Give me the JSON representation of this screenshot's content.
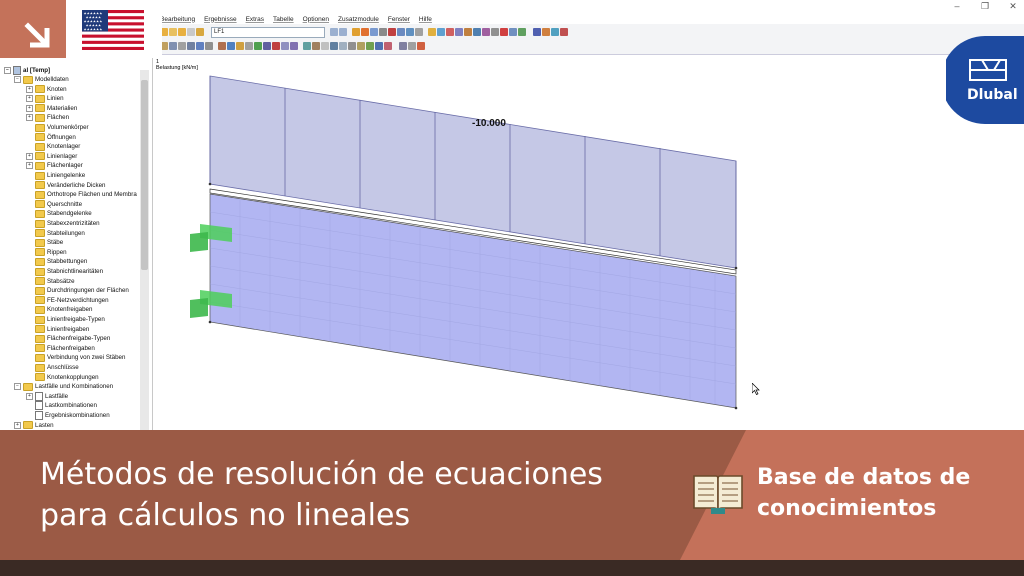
{
  "window": {
    "minimize": "–",
    "restore": "❐",
    "close": "✕"
  },
  "menu": [
    "Bearbeitung",
    "Ergebnisse",
    "Extras",
    "Tabelle",
    "Optionen",
    "Zusatzmodule",
    "Fenster",
    "Hilfe"
  ],
  "toolbar": {
    "loadcase_combo": "LF1"
  },
  "tree": {
    "root": "al [Temp]",
    "items": [
      {
        "label": "Modelldaten",
        "level": 1,
        "expander": "−",
        "icon": "folder"
      },
      {
        "label": "Knoten",
        "level": 2,
        "expander": "+",
        "icon": "folder"
      },
      {
        "label": "Linien",
        "level": 2,
        "expander": "+",
        "icon": "folder"
      },
      {
        "label": "Materialien",
        "level": 2,
        "expander": "+",
        "icon": "folder"
      },
      {
        "label": "Flächen",
        "level": 2,
        "expander": "+",
        "icon": "folder"
      },
      {
        "label": "Volumenkörper",
        "level": 2,
        "expander": "",
        "icon": "folder"
      },
      {
        "label": "Öffnungen",
        "level": 2,
        "expander": "",
        "icon": "folder"
      },
      {
        "label": "Knotenlager",
        "level": 2,
        "expander": "",
        "icon": "folder"
      },
      {
        "label": "Linienlager",
        "level": 2,
        "expander": "+",
        "icon": "folder"
      },
      {
        "label": "Flächenlager",
        "level": 2,
        "expander": "+",
        "icon": "folder"
      },
      {
        "label": "Liniengelenke",
        "level": 2,
        "expander": "",
        "icon": "folder"
      },
      {
        "label": "Veränderliche Dicken",
        "level": 2,
        "expander": "",
        "icon": "folder"
      },
      {
        "label": "Orthotrope Flächen und Membra",
        "level": 2,
        "expander": "",
        "icon": "folder"
      },
      {
        "label": "Querschnitte",
        "level": 2,
        "expander": "",
        "icon": "folder"
      },
      {
        "label": "Stabendgelenke",
        "level": 2,
        "expander": "",
        "icon": "folder"
      },
      {
        "label": "Stabexzentrizitäten",
        "level": 2,
        "expander": "",
        "icon": "folder"
      },
      {
        "label": "Stabteilungen",
        "level": 2,
        "expander": "",
        "icon": "folder"
      },
      {
        "label": "Stäbe",
        "level": 2,
        "expander": "",
        "icon": "folder"
      },
      {
        "label": "Rippen",
        "level": 2,
        "expander": "",
        "icon": "folder"
      },
      {
        "label": "Stabbettungen",
        "level": 2,
        "expander": "",
        "icon": "folder"
      },
      {
        "label": "Stabnichtlinearitäten",
        "level": 2,
        "expander": "",
        "icon": "folder"
      },
      {
        "label": "Stabsätze",
        "level": 2,
        "expander": "",
        "icon": "folder"
      },
      {
        "label": "Durchdringungen der Flächen",
        "level": 2,
        "expander": "",
        "icon": "folder"
      },
      {
        "label": "FE-Netzverdichtungen",
        "level": 2,
        "expander": "",
        "icon": "folder"
      },
      {
        "label": "Knotenfreigaben",
        "level": 2,
        "expander": "",
        "icon": "folder"
      },
      {
        "label": "Linienfreigabe-Typen",
        "level": 2,
        "expander": "",
        "icon": "folder"
      },
      {
        "label": "Linienfreigaben",
        "level": 2,
        "expander": "",
        "icon": "folder"
      },
      {
        "label": "Flächenfreigabe-Typen",
        "level": 2,
        "expander": "",
        "icon": "folder"
      },
      {
        "label": "Flächenfreigaben",
        "level": 2,
        "expander": "",
        "icon": "folder"
      },
      {
        "label": "Verbindung von zwei Stäben",
        "level": 2,
        "expander": "",
        "icon": "folder"
      },
      {
        "label": "Anschlüsse",
        "level": 2,
        "expander": "",
        "icon": "folder"
      },
      {
        "label": "Knotenkopplungen",
        "level": 2,
        "expander": "",
        "icon": "folder"
      },
      {
        "label": "Lastfälle und Kombinationen",
        "level": 1,
        "expander": "−",
        "icon": "folder"
      },
      {
        "label": "Lastfälle",
        "level": 2,
        "expander": "+",
        "icon": "doc"
      },
      {
        "label": "Lastkombinationen",
        "level": 2,
        "expander": "",
        "icon": "doc"
      },
      {
        "label": "Ergebniskombinationen",
        "level": 2,
        "expander": "",
        "icon": "doc"
      },
      {
        "label": "Lasten",
        "level": 1,
        "expander": "+",
        "icon": "folder"
      }
    ]
  },
  "graphic": {
    "loadcase_number": "1",
    "unit_label": "Belastung [kN/m]",
    "load_value": "-10.000",
    "load_color": "#b9bde0",
    "surface_color": "#aab0f0",
    "support_color": "#4ccf5a"
  },
  "flag": "us-flag-icon",
  "logo": {
    "text": "Dlubal",
    "color": "#1d4aa0"
  },
  "banner": {
    "title": "Métodos de resolución de ecuaciones para cálculos no lineales",
    "kb_label": "Base de datos de conocimientos",
    "dark_color": "#9b5a45",
    "light_color": "#c4715a"
  }
}
